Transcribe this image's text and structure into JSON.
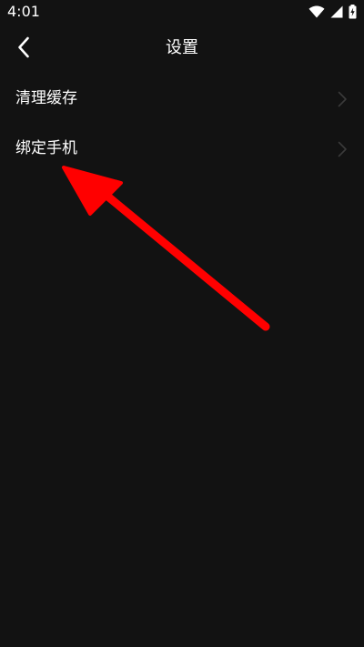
{
  "status_bar": {
    "time": "4:01",
    "icons": [
      "wifi-icon",
      "cell-signal-icon",
      "battery-charging-icon"
    ]
  },
  "nav": {
    "back_icon": "chevron-left-icon",
    "title": "设置"
  },
  "settings": {
    "items": [
      {
        "label": "清理缓存",
        "icon": "chevron-right-icon"
      },
      {
        "label": "绑定手机",
        "icon": "chevron-right-icon"
      }
    ]
  },
  "annotation": {
    "type": "arrow",
    "color": "#ff0000",
    "points_to": "绑定手机"
  },
  "colors": {
    "background": "#121212",
    "text": "#ffffff",
    "chevron": "#3a3a3a",
    "annotation": "#ff0000"
  }
}
